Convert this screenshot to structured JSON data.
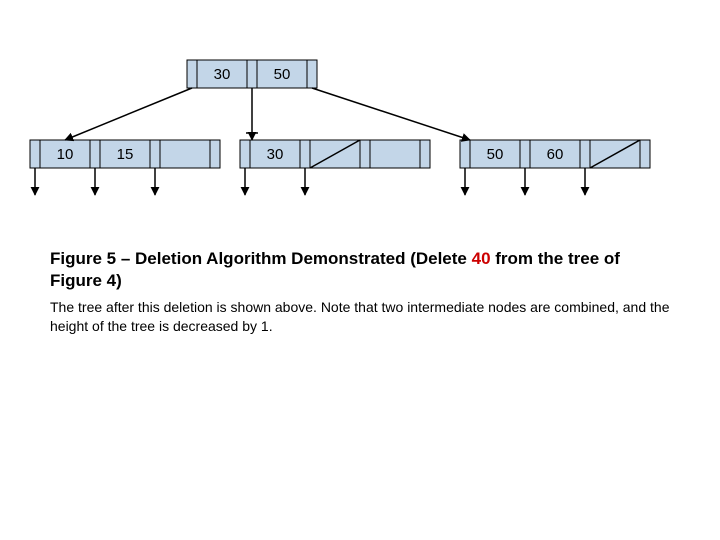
{
  "diagram": {
    "type": "b-tree",
    "fill": "#c3d6e8",
    "root": {
      "keys": [
        "30",
        "50"
      ]
    },
    "leaves": [
      {
        "keys": [
          "10",
          "15"
        ]
      },
      {
        "keys": [
          "30"
        ]
      },
      {
        "keys": [
          "50",
          "60"
        ]
      }
    ]
  },
  "caption": {
    "prefix": "Figure 5 – Deletion Algorithm Demonstrated (Delete ",
    "deleted_value": "40",
    "suffix": " from the tree of Figure 4)"
  },
  "body": "The tree after this deletion is shown above.  Note that two intermediate nodes are  combined, and the height of the tree is decreased by 1."
}
